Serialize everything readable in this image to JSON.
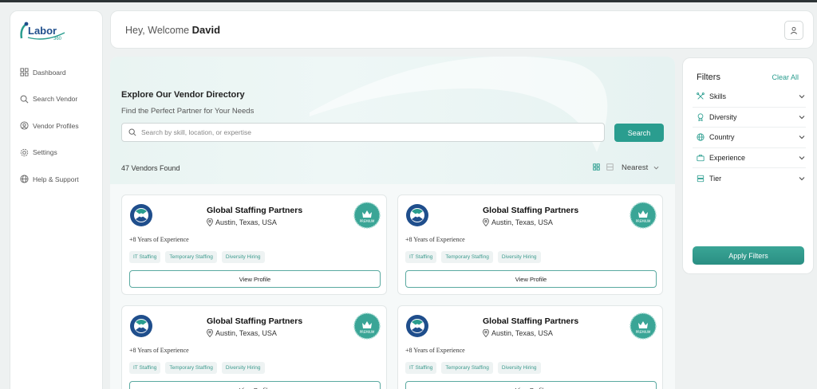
{
  "app": {
    "logo_text": "Labor",
    "logo_sub": "360"
  },
  "sidebar": {
    "items": [
      {
        "label": "Dashboard",
        "icon": "grid-icon"
      },
      {
        "label": "Search Vendor",
        "icon": "search-icon"
      },
      {
        "label": "Vendor Profiles",
        "icon": "user-circle-icon"
      },
      {
        "label": "Settings",
        "icon": "gear-icon"
      },
      {
        "label": "Help & Support",
        "icon": "globe-icon"
      }
    ]
  },
  "header": {
    "greeting": "Hey, Welcome",
    "user_name": "David"
  },
  "hero": {
    "title": "Explore Our Vendor Directory",
    "subtitle": "Find the Perfect Partner for Your Needs",
    "search_placeholder": "Search by skill, location, or expertise",
    "search_button": "Search"
  },
  "results": {
    "count_text": "47 Vendors Found",
    "sort_label": "Nearest"
  },
  "vendors": [
    {
      "name": "Global Staffing Partners",
      "location": "Austin, Texas, USA",
      "badge": "PREMIUM",
      "experience": "+8 Years of Experience",
      "tags": [
        "IT Staffing",
        "Temporary Staffing",
        "Diversity Hiring"
      ],
      "button": "View Profile"
    },
    {
      "name": "Global Staffing Partners",
      "location": "Austin, Texas, USA",
      "badge": "PREMIUM",
      "experience": "+8 Years of Experience",
      "tags": [
        "IT Staffing",
        "Temporary Staffing",
        "Diversity Hiring"
      ],
      "button": "View Profile"
    },
    {
      "name": "Global Staffing Partners",
      "location": "Austin, Texas, USA",
      "badge": "PREMIUM",
      "experience": "+8 Years of Experience",
      "tags": [
        "IT Staffing",
        "Temporary Staffing",
        "Diversity Hiring"
      ],
      "button": "View Profile"
    },
    {
      "name": "Global Staffing Partners",
      "location": "Austin, Texas, USA",
      "badge": "PREMIUM",
      "experience": "+8 Years of Experience",
      "tags": [
        "IT Staffing",
        "Temporary Staffing",
        "Diversity Hiring"
      ],
      "button": "View Profile"
    }
  ],
  "filters": {
    "title": "Filters",
    "clear_all": "Clear All",
    "items": [
      {
        "label": "Skills",
        "icon": "tools-icon"
      },
      {
        "label": "Diversity",
        "icon": "award-icon"
      },
      {
        "label": "Country",
        "icon": "globe-icon"
      },
      {
        "label": "Experience",
        "icon": "briefcase-icon"
      },
      {
        "label": "Tier",
        "icon": "layers-icon"
      }
    ],
    "apply_button": "Apply Filters"
  },
  "colors": {
    "accent": "#2a9d8f",
    "tag_text": "#3d9b8e",
    "logo_blue": "#1f4e8c"
  }
}
